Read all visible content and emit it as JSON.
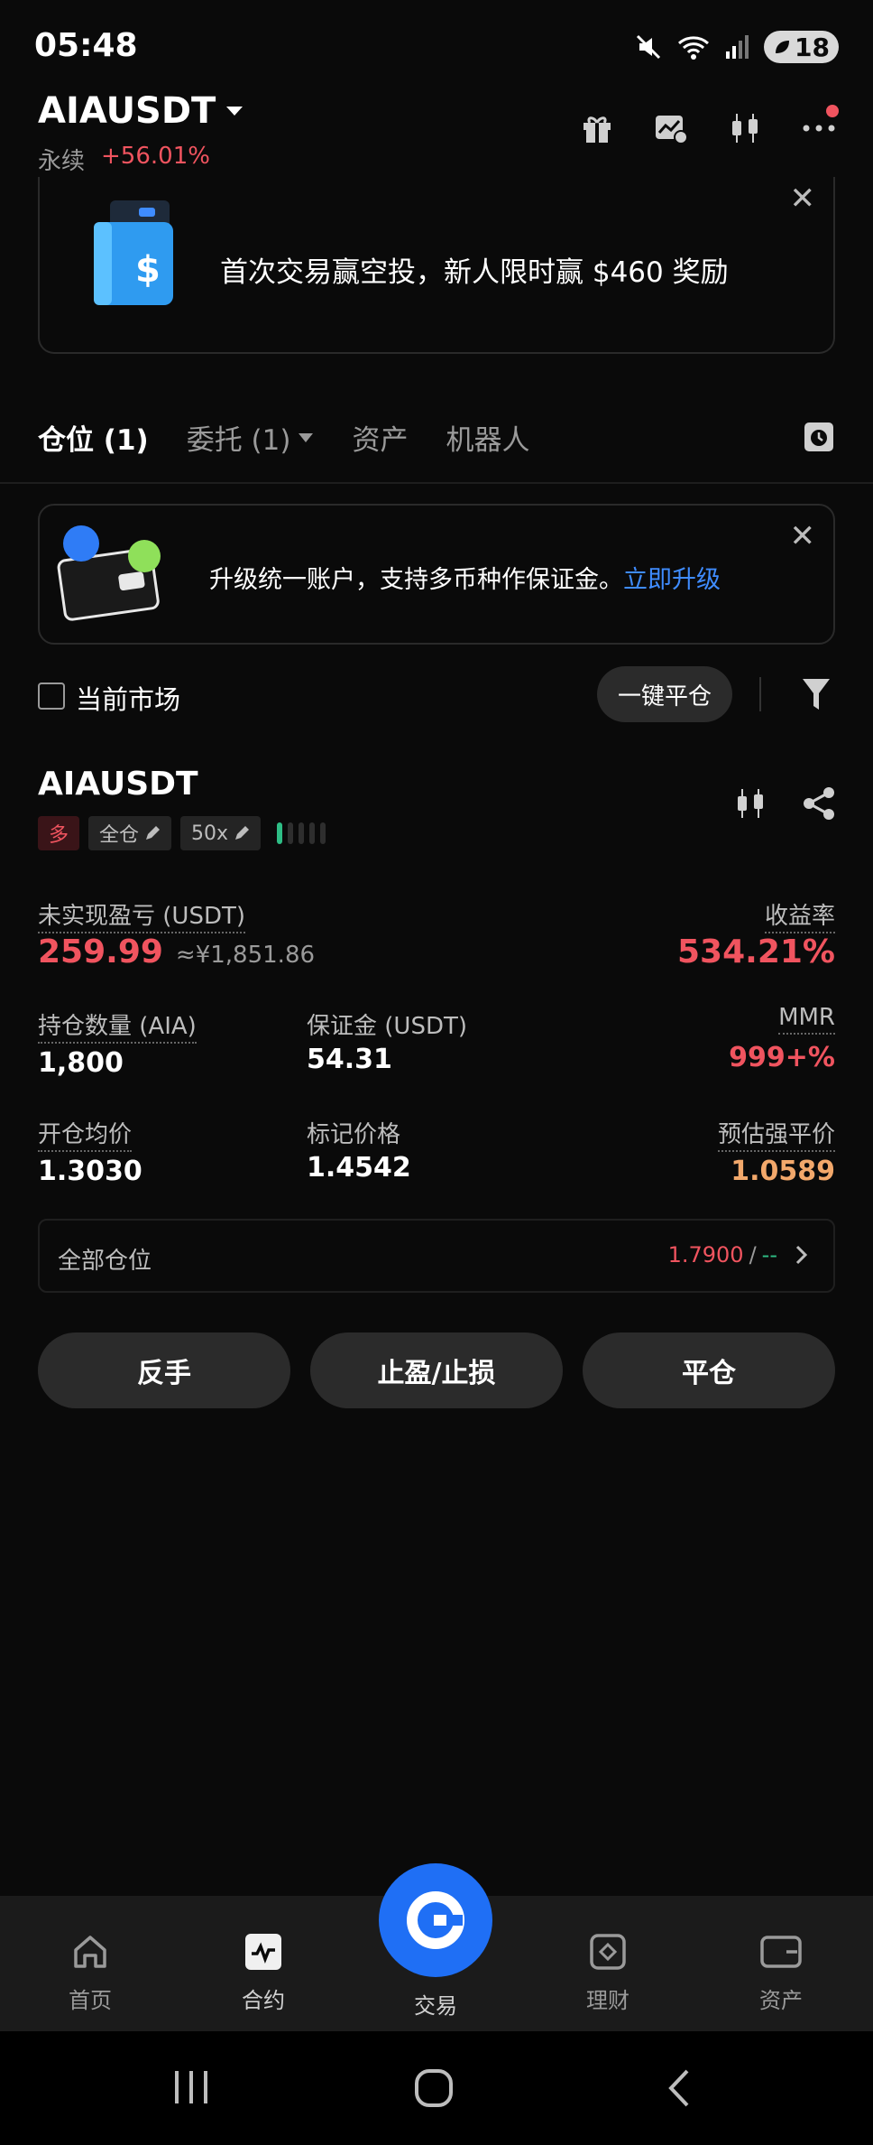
{
  "status_bar": {
    "time": "05:48",
    "battery": "18"
  },
  "header": {
    "pair": "AIAUSDT",
    "type": "永续",
    "change": "+56.01%"
  },
  "promo": {
    "text": "首次交易赢空投，新人限时赢 $460 奖励"
  },
  "tabs": [
    {
      "label": "仓位 (1)"
    },
    {
      "label": "委托 (1)"
    },
    {
      "label": "资产"
    },
    {
      "label": "机器人"
    }
  ],
  "upgrade": {
    "text": "升级统一账户，支持多币种作保证金。",
    "link": "立即升级"
  },
  "filter": {
    "current_market": "当前市场",
    "close_all": "一键平仓"
  },
  "position": {
    "symbol": "AIAUSDT",
    "side": "多",
    "margin_mode": "全仓",
    "leverage": "50x",
    "adl_level": 1,
    "unrealized_label": "未实现盈亏 (USDT)",
    "unrealized_value": "259.99",
    "unrealized_cny": "≈¥1,851.86",
    "roe_label": "收益率",
    "roe_value": "534.21%",
    "size_label": "持仓数量 (AIA)",
    "size_value": "1,800",
    "margin_label": "保证金 (USDT)",
    "margin_value": "54.31",
    "mmr_label": "MMR",
    "mmr_value": "999+%",
    "entry_label": "开仓均价",
    "entry_value": "1.3030",
    "mark_label": "标记价格",
    "mark_value": "1.4542",
    "liq_label": "预估强平价",
    "liq_value": "1.0589"
  },
  "all_positions": {
    "label": "全部仓位",
    "value": "1.7900",
    "sep": "/",
    "value2": "--"
  },
  "actions": {
    "reverse": "反手",
    "tpsl": "止盈/止损",
    "close": "平仓"
  },
  "bottom_nav": [
    {
      "label": "首页"
    },
    {
      "label": "合约"
    },
    {
      "label": "交易"
    },
    {
      "label": "理财"
    },
    {
      "label": "资产"
    }
  ],
  "colors": {
    "red": "#f0545f",
    "green": "#2ebd85",
    "blue": "#3f8cff",
    "orange": "#f2a86b",
    "brand": "#1f6ff5"
  }
}
